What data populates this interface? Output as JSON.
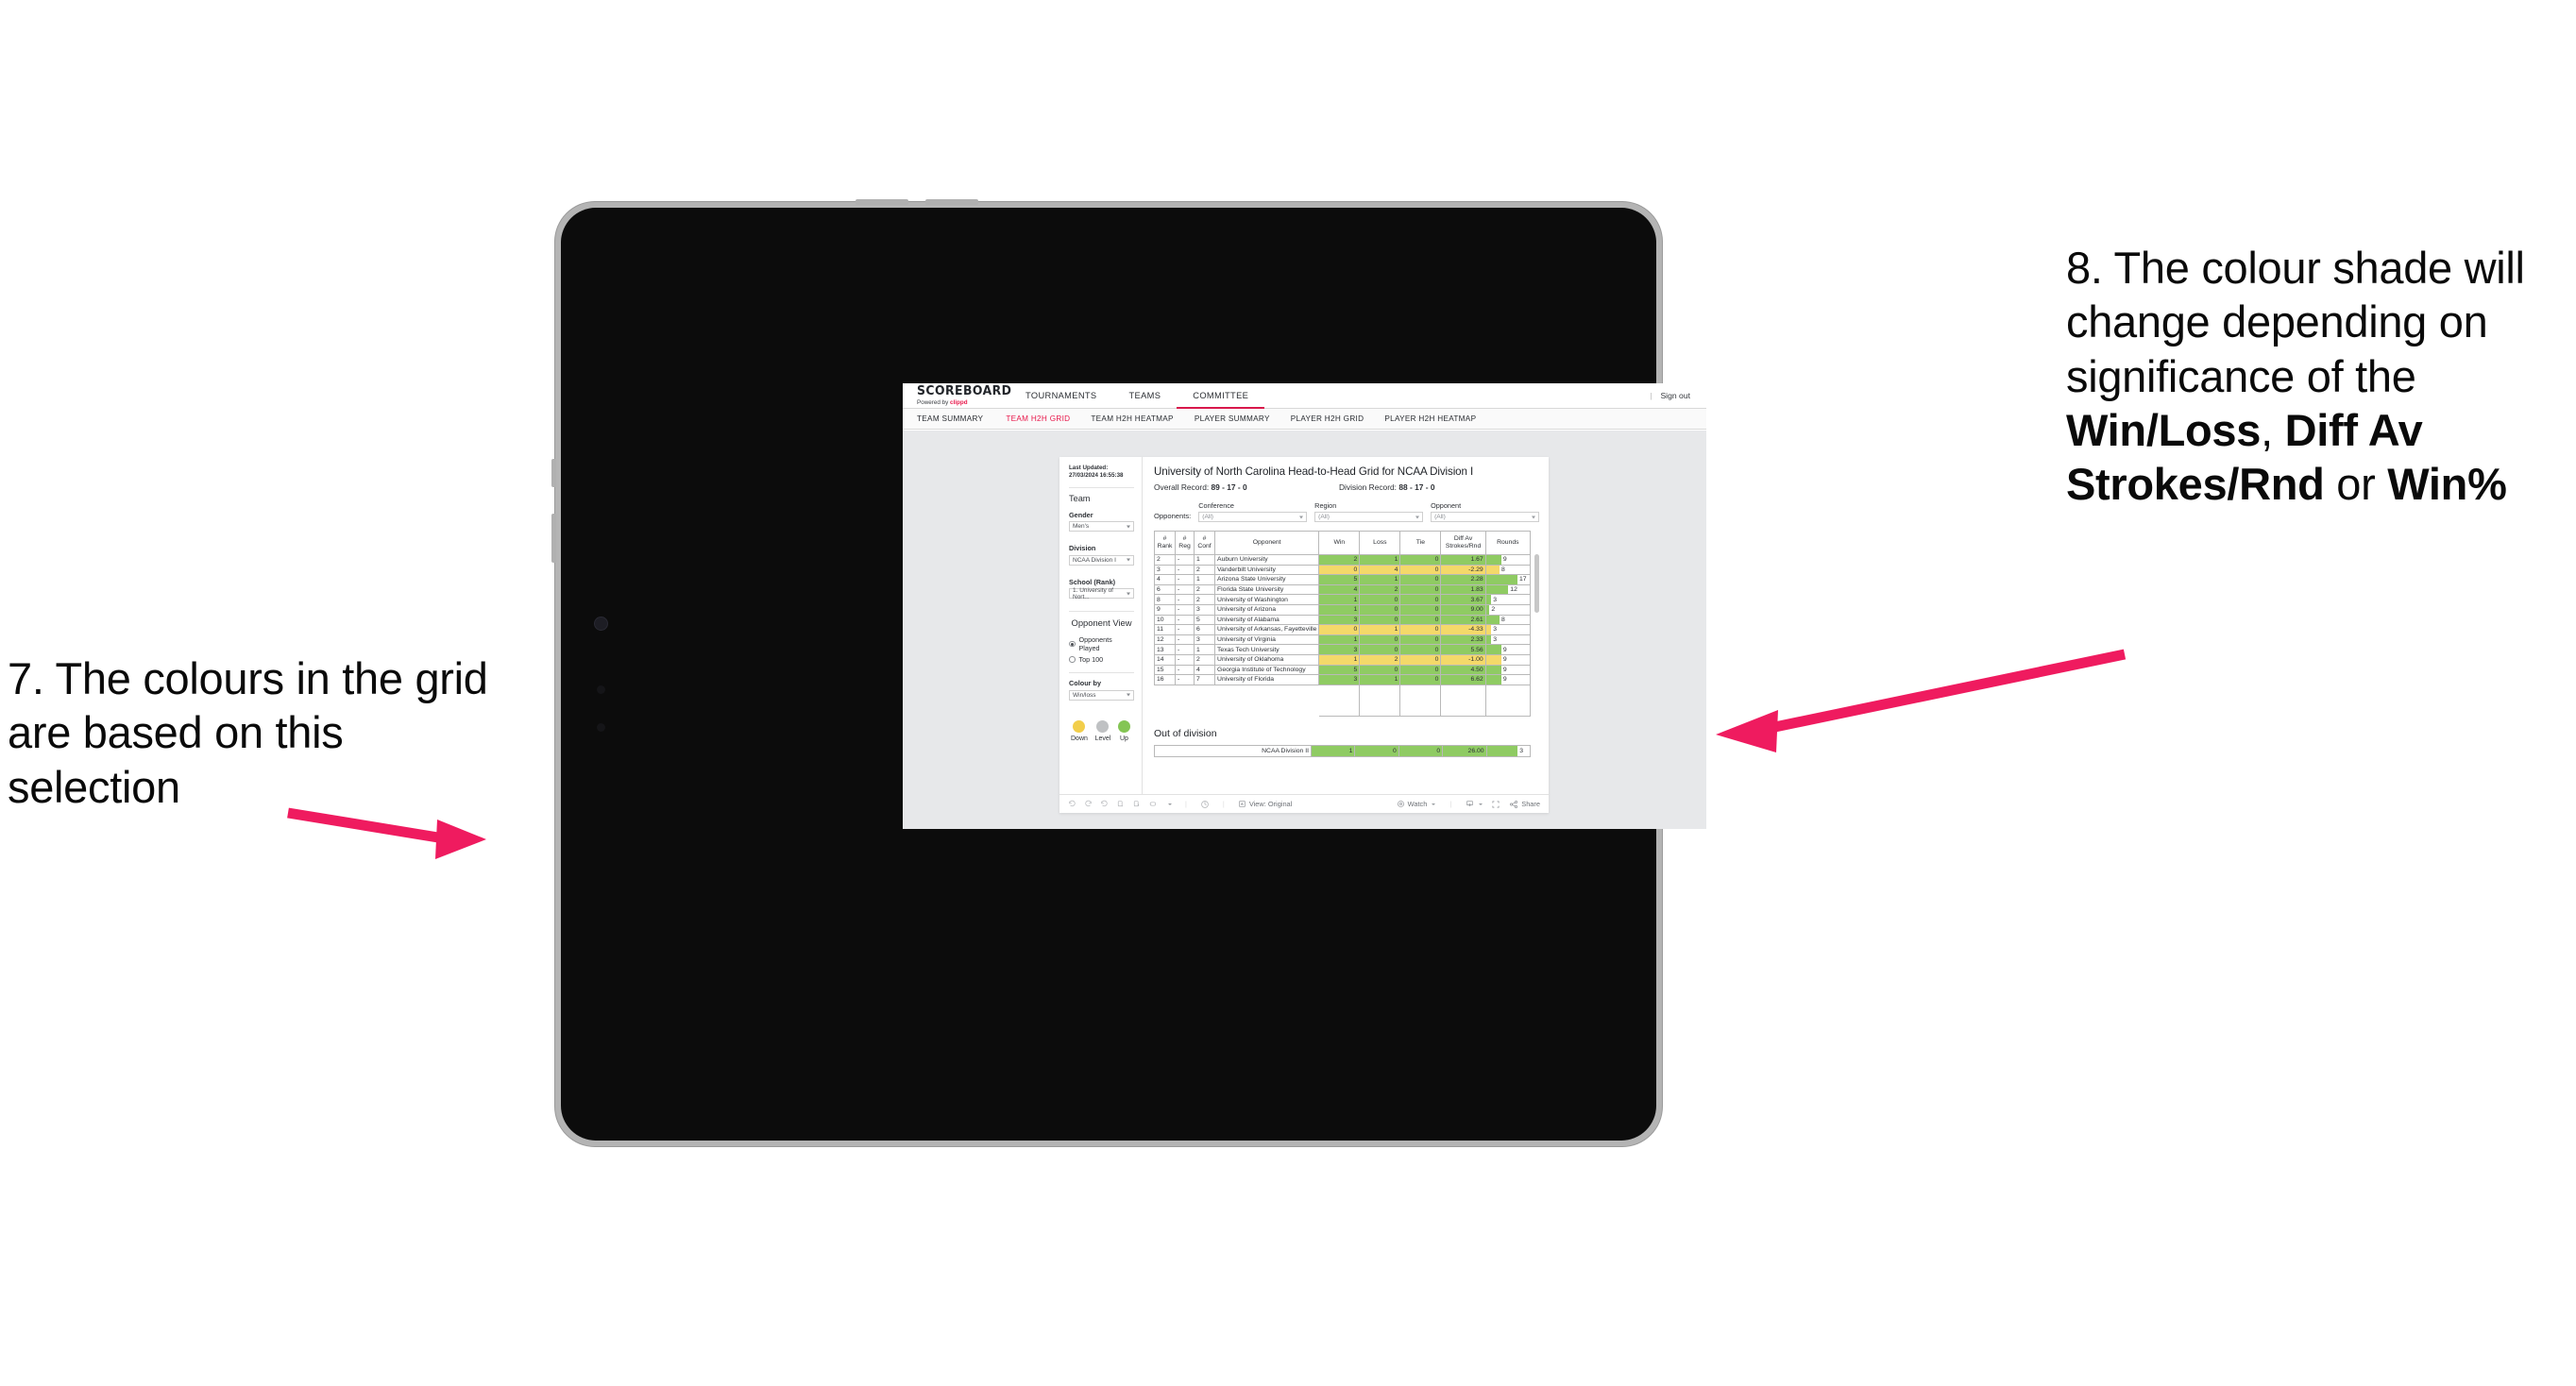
{
  "annotations": {
    "left": {
      "id": "7.",
      "text": "7. The colours in the grid are based on this selection"
    },
    "right": {
      "id": "8.",
      "parts": [
        {
          "t": "8. The colour shade will change depending on significance of the ",
          "bold": false
        },
        {
          "t": "Win/Loss",
          "bold": true
        },
        {
          "t": ", ",
          "bold": false
        },
        {
          "t": "Diff Av Strokes/Rnd",
          "bold": true
        },
        {
          "t": " or ",
          "bold": false
        },
        {
          "t": "Win%",
          "bold": true
        }
      ]
    },
    "arrow_color": "#EF1B5F"
  },
  "app": {
    "logo": {
      "main": "SCOREBOARD",
      "sub_prefix": "Powered by ",
      "sub_brand": "clippd"
    },
    "nav": [
      {
        "label": "TOURNAMENTS",
        "active": false
      },
      {
        "label": "TEAMS",
        "active": false
      },
      {
        "label": "COMMITTEE",
        "active": true
      }
    ],
    "sign_out": "Sign out",
    "sign_out_sep": "|",
    "subnav": [
      {
        "label": "TEAM SUMMARY",
        "active": false
      },
      {
        "label": "TEAM H2H GRID",
        "active": true
      },
      {
        "label": "TEAM H2H HEATMAP",
        "active": false
      },
      {
        "label": "PLAYER SUMMARY",
        "active": false
      },
      {
        "label": "PLAYER H2H GRID",
        "active": false
      },
      {
        "label": "PLAYER H2H HEATMAP",
        "active": false
      }
    ],
    "accent": "#E8174A"
  },
  "sidebar": {
    "last_updated": "Last Updated: 27/03/2024 16:55:38",
    "team_heading": "Team",
    "gender": {
      "label": "Gender",
      "value": "Men's"
    },
    "division": {
      "label": "Division",
      "value": "NCAA Division I"
    },
    "school": {
      "label": "School (Rank)",
      "value": "1. University of Nort..."
    },
    "opponent_view": {
      "heading": "Opponent View",
      "options": [
        {
          "label": "Opponents Played",
          "selected": true
        },
        {
          "label": "Top 100",
          "selected": false
        }
      ]
    },
    "colour_by": {
      "label": "Colour by",
      "value": "Win/loss"
    },
    "legend": [
      {
        "label": "Down",
        "color": "#F2CE4B"
      },
      {
        "label": "Level",
        "color": "#BFC1C3"
      },
      {
        "label": "Up",
        "color": "#84C554"
      }
    ]
  },
  "main": {
    "title": "University of North Carolina Head-to-Head Grid for NCAA Division I",
    "overall_record": {
      "label": "Overall Record: ",
      "value": "89 - 17 - 0"
    },
    "division_record": {
      "label": "Division Record: ",
      "value": "88 - 17 - 0"
    },
    "opponents_label": "Opponents:",
    "filters": [
      {
        "label": "Conference",
        "value": "(All)"
      },
      {
        "label": "Region",
        "value": "(All)"
      },
      {
        "label": "Opponent",
        "value": "(All)"
      }
    ],
    "out_of_division": {
      "title": "Out of division",
      "row": {
        "label": "NCAA Division II",
        "win": "1",
        "loss": "0",
        "tie": "0",
        "diff": "26.00",
        "rounds": "3",
        "rounds_bar_pct": 72,
        "color": "#8FCB63"
      }
    }
  },
  "toolbar": {
    "view_label": "View: Original",
    "watch_label": "Watch",
    "share_label": "Share"
  },
  "chart_data": {
    "type": "table",
    "title": "University of North Carolina Head-to-Head Grid for NCAA Division I",
    "colors": {
      "up": "#8FCB63",
      "down": "#F4D96A",
      "level": "#BFC1C3",
      "rounds_bar": "#8FCB63",
      "rounds_bar_down": "#F4D96A"
    },
    "columns": [
      "# Rank",
      "# Reg",
      "# Conf",
      "Opponent",
      "Win",
      "Loss",
      "Tie",
      "Diff Av Strokes/Rnd",
      "Rounds"
    ],
    "column_headers_split": [
      {
        "l1": "#",
        "l2": "Rank"
      },
      {
        "l1": "#",
        "l2": "Reg"
      },
      {
        "l1": "#",
        "l2": "Conf"
      },
      {
        "l1": "Opponent",
        "l2": ""
      },
      {
        "l1": "Win",
        "l2": ""
      },
      {
        "l1": "Loss",
        "l2": ""
      },
      {
        "l1": "Tie",
        "l2": ""
      },
      {
        "l1": "Diff Av",
        "l2": "Strokes/Rnd"
      },
      {
        "l1": "Rounds",
        "l2": ""
      }
    ],
    "rows": [
      {
        "rank": "2",
        "reg": "-",
        "conf": "1",
        "opponent": "Auburn University",
        "win": "2",
        "loss": "1",
        "tie": "0",
        "diff": "1.67",
        "rounds": "9",
        "state": "up",
        "bar_pct": 35
      },
      {
        "rank": "3",
        "reg": "-",
        "conf": "2",
        "opponent": "Vanderbilt University",
        "win": "0",
        "loss": "4",
        "tie": "0",
        "diff": "-2.29",
        "rounds": "8",
        "state": "down",
        "bar_pct": 31
      },
      {
        "rank": "4",
        "reg": "-",
        "conf": "1",
        "opponent": "Arizona State University",
        "win": "5",
        "loss": "1",
        "tie": "0",
        "diff": "2.28",
        "rounds": "17",
        "state": "up",
        "bar_pct": 72
      },
      {
        "rank": "6",
        "reg": "-",
        "conf": "2",
        "opponent": "Florida State University",
        "win": "4",
        "loss": "2",
        "tie": "0",
        "diff": "1.83",
        "rounds": "12",
        "state": "up",
        "bar_pct": 51
      },
      {
        "rank": "8",
        "reg": "-",
        "conf": "2",
        "opponent": "University of Washington",
        "win": "1",
        "loss": "0",
        "tie": "0",
        "diff": "3.67",
        "rounds": "3",
        "state": "up",
        "bar_pct": 12
      },
      {
        "rank": "9",
        "reg": "-",
        "conf": "3",
        "opponent": "University of Arizona",
        "win": "1",
        "loss": "0",
        "tie": "0",
        "diff": "9.00",
        "rounds": "2",
        "state": "up",
        "bar_pct": 8
      },
      {
        "rank": "10",
        "reg": "-",
        "conf": "5",
        "opponent": "University of Alabama",
        "win": "3",
        "loss": "0",
        "tie": "0",
        "diff": "2.61",
        "rounds": "8",
        "state": "up",
        "bar_pct": 31
      },
      {
        "rank": "11",
        "reg": "-",
        "conf": "6",
        "opponent": "University of Arkansas, Fayetteville",
        "win": "0",
        "loss": "1",
        "tie": "0",
        "diff": "-4.33",
        "rounds": "3",
        "state": "down",
        "bar_pct": 12
      },
      {
        "rank": "12",
        "reg": "-",
        "conf": "3",
        "opponent": "University of Virginia",
        "win": "1",
        "loss": "0",
        "tie": "0",
        "diff": "2.33",
        "rounds": "3",
        "state": "up",
        "bar_pct": 12
      },
      {
        "rank": "13",
        "reg": "-",
        "conf": "1",
        "opponent": "Texas Tech University",
        "win": "3",
        "loss": "0",
        "tie": "0",
        "diff": "5.56",
        "rounds": "9",
        "state": "up",
        "bar_pct": 35
      },
      {
        "rank": "14",
        "reg": "-",
        "conf": "2",
        "opponent": "University of Oklahoma",
        "win": "1",
        "loss": "2",
        "tie": "0",
        "diff": "-1.00",
        "rounds": "9",
        "state": "down",
        "bar_pct": 35
      },
      {
        "rank": "15",
        "reg": "-",
        "conf": "4",
        "opponent": "Georgia Institute of Technology",
        "win": "5",
        "loss": "0",
        "tie": "0",
        "diff": "4.50",
        "rounds": "9",
        "state": "up",
        "bar_pct": 35
      },
      {
        "rank": "16",
        "reg": "-",
        "conf": "7",
        "opponent": "University of Florida",
        "win": "3",
        "loss": "1",
        "tie": "0",
        "diff": "6.62",
        "rounds": "9",
        "state": "up",
        "bar_pct": 35
      }
    ]
  }
}
